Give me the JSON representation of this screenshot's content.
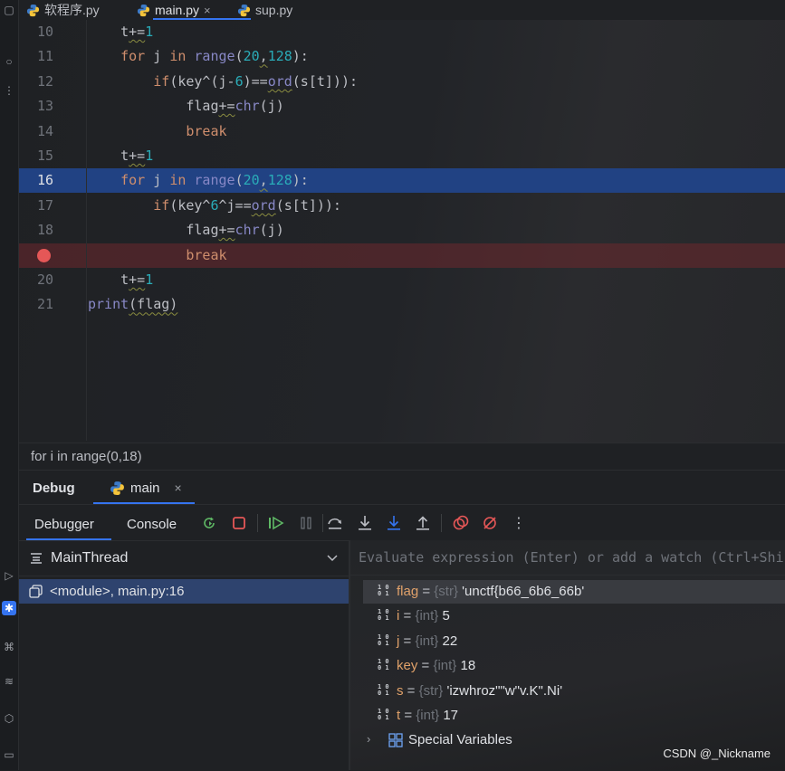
{
  "tabs": [
    {
      "label": "软程序.py",
      "active": false
    },
    {
      "label": "main.py",
      "active": true,
      "close_icon": "×"
    },
    {
      "label": "sup.py",
      "active": false
    }
  ],
  "editor": {
    "lines": [
      {
        "num": "10",
        "indent": "    ",
        "code": [
          [
            "pl",
            "t"
          ],
          [
            "pl",
            "+="
          ],
          [
            "num",
            "1"
          ]
        ]
      },
      {
        "num": "11",
        "indent": "    ",
        "code": [
          [
            "kw",
            "for"
          ],
          [
            "pl",
            " j "
          ],
          [
            "kw",
            "in"
          ],
          [
            "pl",
            " "
          ],
          [
            "bi",
            "range"
          ],
          [
            "pl",
            "("
          ],
          [
            "num",
            "20"
          ],
          [
            "pl",
            ","
          ],
          [
            "num",
            "128"
          ],
          [
            "pl",
            "):"
          ]
        ]
      },
      {
        "num": "12",
        "indent": "        ",
        "code": [
          [
            "kw",
            "if"
          ],
          [
            "pl",
            "(key^(j-"
          ],
          [
            "num",
            "6"
          ],
          [
            "pl",
            ")=="
          ],
          [
            "bi",
            "ord"
          ],
          [
            "pl",
            "(s[t])):"
          ]
        ]
      },
      {
        "num": "13",
        "indent": "            ",
        "code": [
          [
            "pl",
            "flag"
          ],
          [
            "pl",
            "+="
          ],
          [
            "bi",
            "chr"
          ],
          [
            "pl",
            "(j)"
          ]
        ]
      },
      {
        "num": "14",
        "indent": "            ",
        "code": [
          [
            "kw",
            "break"
          ]
        ]
      },
      {
        "num": "15",
        "indent": "    ",
        "code": [
          [
            "pl",
            "t"
          ],
          [
            "pl",
            "+="
          ],
          [
            "num",
            "1"
          ]
        ]
      },
      {
        "num": "16",
        "indent": "    ",
        "code": [
          [
            "kw",
            "for"
          ],
          [
            "pl",
            " j "
          ],
          [
            "kw",
            "in"
          ],
          [
            "pl",
            " "
          ],
          [
            "bi",
            "range"
          ],
          [
            "pl",
            "("
          ],
          [
            "num",
            "20"
          ],
          [
            "pl",
            ","
          ],
          [
            "num",
            "128"
          ],
          [
            "pl",
            "):"
          ]
        ]
      },
      {
        "num": "17",
        "indent": "        ",
        "code": [
          [
            "kw",
            "if"
          ],
          [
            "pl",
            "(key^"
          ],
          [
            "num",
            "6"
          ],
          [
            "pl",
            "^j=="
          ],
          [
            "bi",
            "ord"
          ],
          [
            "pl",
            "(s[t])):"
          ]
        ]
      },
      {
        "num": "18",
        "indent": "            ",
        "code": [
          [
            "pl",
            "flag"
          ],
          [
            "pl",
            "+="
          ],
          [
            "bi",
            "chr"
          ],
          [
            "pl",
            "(j)"
          ]
        ]
      },
      {
        "num": "",
        "indent": "            ",
        "code": [
          [
            "kw",
            "break"
          ]
        ]
      },
      {
        "num": "20",
        "indent": "    ",
        "code": [
          [
            "pl",
            "t"
          ],
          [
            "pl",
            "+="
          ],
          [
            "num",
            "1"
          ]
        ]
      },
      {
        "num": "21",
        "indent": "",
        "code": [
          [
            "bi",
            "print"
          ],
          [
            "pl",
            "(flag)"
          ]
        ]
      }
    ],
    "execution_line": "16",
    "breakpoint_line_index": 9
  },
  "breadcrumb": "for i in range(0,18)",
  "debug": {
    "title": "Debug",
    "run_tab_label": "main",
    "run_tab_close": "×",
    "subtabs": [
      "Debugger",
      "Console"
    ],
    "toolbar_icons": [
      "rerun-icon",
      "stop-icon",
      "resume-icon",
      "pause-icon",
      "step-over-icon",
      "step-into-icon",
      "step-into-my-code-icon",
      "step-out-icon",
      "view-breakpoints-icon",
      "mute-breakpoints-icon",
      "more-icon"
    ],
    "colors": {
      "accent": "#3574f0",
      "resume": "#5fb865",
      "stop": "#e55757",
      "selected_frame": "#2e436e",
      "exec_line": "#214283"
    }
  },
  "frames": {
    "thread": "MainThread",
    "frame": "<module>, main.py:16"
  },
  "variables": {
    "watch_placeholder": "Evaluate expression (Enter) or add a watch (Ctrl+Shift+Enter)",
    "items": [
      {
        "name": "flag",
        "type": "{str}",
        "value": "'unctf{b66_6b6_66b'"
      },
      {
        "name": "i",
        "type": "{int}",
        "value": "5"
      },
      {
        "name": "j",
        "type": "{int}",
        "value": "22"
      },
      {
        "name": "key",
        "type": "{int}",
        "value": "18"
      },
      {
        "name": "s",
        "type": "{str}",
        "value": "'izwhroz\"\"w\"v.K\".Ni'"
      },
      {
        "name": "t",
        "type": "{int}",
        "value": "17"
      }
    ],
    "special_label": "Special Variables",
    "eq": " = "
  },
  "watermark": "CSDN @_Nickname"
}
